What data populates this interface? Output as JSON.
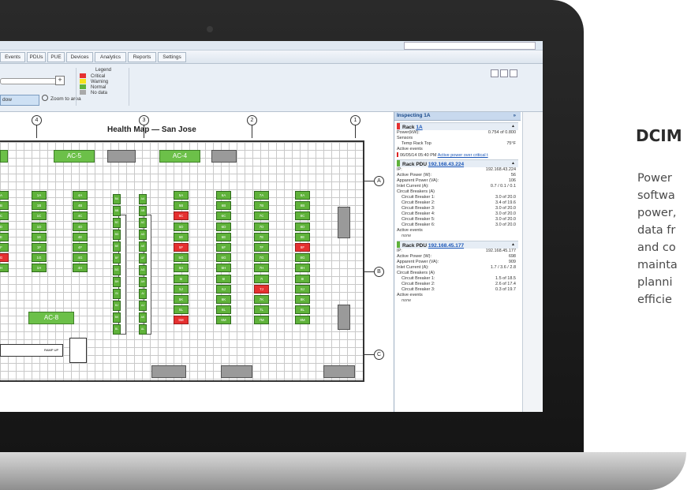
{
  "nav_tabs": [
    "Events",
    "PDUs",
    "PUE",
    "Devices",
    "Analytics",
    "Reports",
    "Settings"
  ],
  "toolbar": {
    "window_btn": "dow",
    "zoom_area": "Zoom to area",
    "plus": "+"
  },
  "legend": {
    "title": "Legend",
    "items": [
      {
        "label": "Critical",
        "color": "#e53030"
      },
      {
        "label": "Warning",
        "color": "#f5e21c"
      },
      {
        "label": "Normal",
        "color": "#5fb23a"
      },
      {
        "label": "No data",
        "color": "#a9a9a9"
      }
    ]
  },
  "map": {
    "title": "Health Map — San Jose",
    "column_markers": [
      "4",
      "3",
      "2",
      "1"
    ],
    "row_markers": [
      "A",
      "B",
      "C"
    ],
    "ac_units": [
      "AC-5",
      "AC-4",
      "AC-8"
    ],
    "ramp_label": "RAMP UP"
  },
  "racks": {
    "c0": [
      "A",
      "B",
      "C",
      "D",
      "E",
      "F",
      "G",
      "H"
    ],
    "c1": [
      "1A",
      "1B",
      "1C",
      "1D",
      "1E",
      "1F",
      "1G",
      "1H"
    ],
    "c2": [
      "4A",
      "4B",
      "4C",
      "4D",
      "4E",
      "4F",
      "4G",
      "4H"
    ],
    "c3": [
      "5A",
      "5B",
      "5C",
      "5D",
      "5E",
      "5F",
      "5G",
      "5H",
      "5I",
      "5J",
      "5K",
      "5L",
      "5M"
    ],
    "c4": [
      "6A",
      "6B",
      "6C",
      "6D",
      "6E",
      "6F",
      "6G",
      "6H",
      "6I",
      "6J",
      "6K",
      "6L",
      "6M"
    ],
    "c5": [
      "7A",
      "7B",
      "7C",
      "7D",
      "7E",
      "7F",
      "7G",
      "7H",
      "7I",
      "7J",
      "7K",
      "7L",
      "7M"
    ],
    "c6": [
      "8A",
      "8B",
      "8C",
      "8D",
      "8E",
      "8F",
      "8G",
      "8H",
      "8I",
      "8J",
      "8K",
      "8L",
      "8M"
    ],
    "v1": [
      "BA",
      "BB",
      "BC",
      "BD",
      "BE",
      "BF",
      "BG",
      "BH",
      "BI",
      "BJ",
      "BK",
      "BL"
    ],
    "v2": [
      "AA",
      "AB",
      "AC",
      "AD",
      "AE",
      "AF",
      "AG",
      "AH",
      "AI",
      "AJ",
      "AK",
      "AL"
    ]
  },
  "inspect": {
    "header": "Inspecting 1A",
    "header_btn": "»",
    "rack": {
      "title_prefix": "Rack",
      "title_link": "1A",
      "power_label": "Power(kW):",
      "power_value": "0.754 of 0.800",
      "sensors_label": "Sensors",
      "sensor_name": "Temp Rack Top",
      "sensor_value": "75°F",
      "events_label": "Active events",
      "event_time": "06/05/14 05:40 PM",
      "event_link": "Active power over critical t"
    },
    "pdu1": {
      "title_prefix": "Rack PDU",
      "title_link": "192.168.43.224",
      "ip_label": "IP:",
      "ip_value": "192.168.43.224",
      "ap_label": "Active Power (W):",
      "ap_value": "56",
      "app_label": "Apparent Power (VA):",
      "app_value": "106",
      "ic_label": "Inlet Current (A):",
      "ic_value": "0.7 / 0.1 / 0.1",
      "cb_label": "Circuit Breakers (A)",
      "breakers": [
        {
          "label": "Circuit Breaker 1:",
          "value": "3.0 of 20.0"
        },
        {
          "label": "Circuit Breaker 2:",
          "value": "3.4 of 19.6"
        },
        {
          "label": "Circuit Breaker 3:",
          "value": "3.0 of 20.0"
        },
        {
          "label": "Circuit Breaker 4:",
          "value": "3.0 of 20.0"
        },
        {
          "label": "Circuit Breaker 5:",
          "value": "3.0 of 20.0"
        },
        {
          "label": "Circuit Breaker 6:",
          "value": "3.0 of 20.0"
        }
      ],
      "events_label": "Active events",
      "events_value": "none"
    },
    "pdu2": {
      "title_prefix": "Rack PDU",
      "title_link": "192.168.45.177",
      "ip_label": "IP:",
      "ip_value": "192.168.45.177",
      "ap_label": "Active Power (W):",
      "ap_value": "698",
      "app_label": "Apparent Power (VA):",
      "app_value": "909",
      "ic_label": "Inlet Current (A):",
      "ic_value": "1.7 / 3.6 / 2.8",
      "cb_label": "Circuit Breakers (A)",
      "breakers": [
        {
          "label": "Circuit Breaker 1:",
          "value": "1.5 of 18.5"
        },
        {
          "label": "Circuit Breaker 2:",
          "value": "2.6 of 17.4"
        },
        {
          "label": "Circuit Breaker 3:",
          "value": "0.3 of 19.7"
        }
      ],
      "events_label": "Active events",
      "events_value": "none"
    }
  },
  "marketing": {
    "heading": "DCIM",
    "lines": [
      "Power",
      "softwa",
      "power,",
      "data fr",
      "and co",
      "mainta",
      "planni",
      "efficie"
    ]
  }
}
